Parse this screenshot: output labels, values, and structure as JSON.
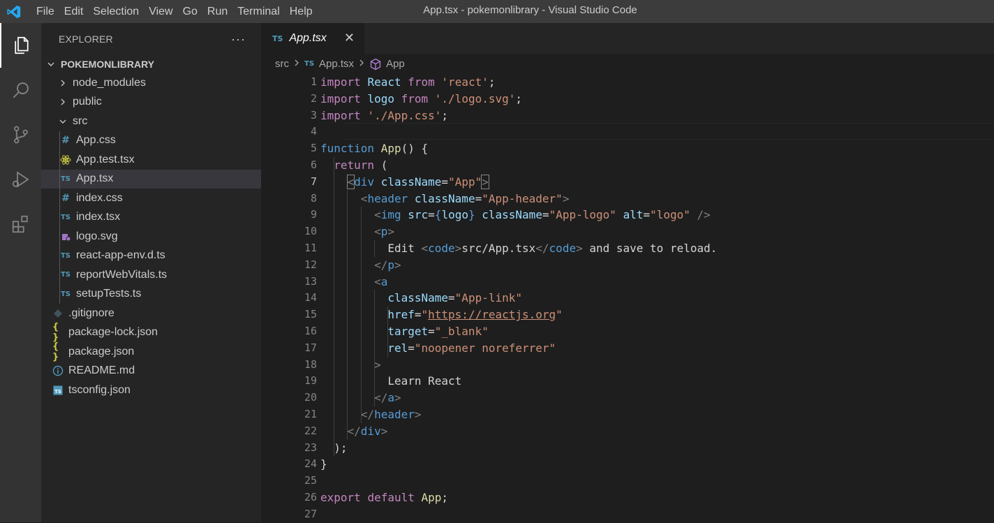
{
  "menu": [
    "File",
    "Edit",
    "Selection",
    "View",
    "Go",
    "Run",
    "Terminal",
    "Help"
  ],
  "window_title": "App.tsx - pokemonlibrary - Visual Studio Code",
  "explorer": {
    "title": "EXPLORER",
    "more": "···",
    "project": "POKEMONLIBRARY",
    "items": [
      {
        "label": "node_modules",
        "type": "folder",
        "open": false
      },
      {
        "label": "public",
        "type": "folder",
        "open": false
      },
      {
        "label": "src",
        "type": "folder",
        "open": true
      },
      {
        "label": "App.css",
        "type": "css"
      },
      {
        "label": "App.test.tsx",
        "type": "react"
      },
      {
        "label": "App.tsx",
        "type": "ts",
        "selected": true
      },
      {
        "label": "index.css",
        "type": "css"
      },
      {
        "label": "index.tsx",
        "type": "ts"
      },
      {
        "label": "logo.svg",
        "type": "svg"
      },
      {
        "label": "react-app-env.d.ts",
        "type": "ts"
      },
      {
        "label": "reportWebVitals.ts",
        "type": "ts"
      },
      {
        "label": "setupTests.ts",
        "type": "ts"
      },
      {
        "label": ".gitignore",
        "type": "git"
      },
      {
        "label": "package-lock.json",
        "type": "json"
      },
      {
        "label": "package.json",
        "type": "json"
      },
      {
        "label": "README.md",
        "type": "info"
      },
      {
        "label": "tsconfig.json",
        "type": "tsconfig"
      }
    ]
  },
  "icons": {
    "ts": "TS",
    "css": "#",
    "json": "{ }"
  },
  "tab": {
    "label": "App.tsx",
    "close": "✕"
  },
  "breadcrumb": {
    "folder": "src",
    "file": "App.tsx",
    "symbol": "App"
  },
  "code_lines": [
    [
      [
        "k",
        "import"
      ],
      [
        "w",
        " "
      ],
      [
        "v",
        "React"
      ],
      [
        "w",
        " "
      ],
      [
        "k",
        "from"
      ],
      [
        "w",
        " "
      ],
      [
        "s",
        "'react'"
      ],
      [
        "w",
        ";"
      ]
    ],
    [
      [
        "k",
        "import"
      ],
      [
        "w",
        " "
      ],
      [
        "v",
        "logo"
      ],
      [
        "w",
        " "
      ],
      [
        "k",
        "from"
      ],
      [
        "w",
        " "
      ],
      [
        "s",
        "'./logo.svg'"
      ],
      [
        "w",
        ";"
      ]
    ],
    [
      [
        "k",
        "import"
      ],
      [
        "w",
        " "
      ],
      [
        "s",
        "'./App.css'"
      ],
      [
        "w",
        ";"
      ]
    ],
    [],
    [
      [
        "b",
        "function"
      ],
      [
        "w",
        " "
      ],
      [
        "f",
        "App"
      ],
      [
        "w",
        "() {"
      ]
    ],
    [
      [
        "w",
        "  "
      ],
      [
        "k",
        "return"
      ],
      [
        "w",
        " ("
      ]
    ],
    [
      [
        "w",
        "    "
      ],
      [
        "g",
        "<"
      ],
      [
        "b",
        "div"
      ],
      [
        "w",
        " "
      ],
      [
        "v",
        "className"
      ],
      [
        "w",
        "="
      ],
      [
        "s",
        "\"App\""
      ],
      [
        "g",
        ">"
      ]
    ],
    [
      [
        "w",
        "      "
      ],
      [
        "g",
        "<"
      ],
      [
        "b",
        "header"
      ],
      [
        "w",
        " "
      ],
      [
        "v",
        "className"
      ],
      [
        "w",
        "="
      ],
      [
        "s",
        "\"App-header\""
      ],
      [
        "g",
        ">"
      ]
    ],
    [
      [
        "w",
        "        "
      ],
      [
        "g",
        "<"
      ],
      [
        "b",
        "img"
      ],
      [
        "w",
        " "
      ],
      [
        "v",
        "src"
      ],
      [
        "w",
        "="
      ],
      [
        "b",
        "{"
      ],
      [
        "v",
        "logo"
      ],
      [
        "b",
        "}"
      ],
      [
        "w",
        " "
      ],
      [
        "v",
        "className"
      ],
      [
        "w",
        "="
      ],
      [
        "s",
        "\"App-logo\""
      ],
      [
        "w",
        " "
      ],
      [
        "v",
        "alt"
      ],
      [
        "w",
        "="
      ],
      [
        "s",
        "\"logo\""
      ],
      [
        "w",
        " "
      ],
      [
        "g",
        "/>"
      ]
    ],
    [
      [
        "w",
        "        "
      ],
      [
        "g",
        "<"
      ],
      [
        "b",
        "p"
      ],
      [
        "g",
        ">"
      ]
    ],
    [
      [
        "w",
        "          Edit "
      ],
      [
        "g",
        "<"
      ],
      [
        "b",
        "code"
      ],
      [
        "g",
        ">"
      ],
      [
        "w",
        "src/App.tsx"
      ],
      [
        "g",
        "</"
      ],
      [
        "b",
        "code"
      ],
      [
        "g",
        ">"
      ],
      [
        "w",
        " and save to reload."
      ]
    ],
    [
      [
        "w",
        "        "
      ],
      [
        "g",
        "</"
      ],
      [
        "b",
        "p"
      ],
      [
        "g",
        ">"
      ]
    ],
    [
      [
        "w",
        "        "
      ],
      [
        "g",
        "<"
      ],
      [
        "b",
        "a"
      ]
    ],
    [
      [
        "w",
        "          "
      ],
      [
        "v",
        "className"
      ],
      [
        "w",
        "="
      ],
      [
        "s",
        "\"App-link\""
      ]
    ],
    [
      [
        "w",
        "          "
      ],
      [
        "v",
        "href"
      ],
      [
        "w",
        "="
      ],
      [
        "s",
        "\""
      ],
      [
        "su",
        "https://reactjs.org"
      ],
      [
        "s",
        "\""
      ]
    ],
    [
      [
        "w",
        "          "
      ],
      [
        "v",
        "target"
      ],
      [
        "w",
        "="
      ],
      [
        "s",
        "\"_blank\""
      ]
    ],
    [
      [
        "w",
        "          "
      ],
      [
        "v",
        "rel"
      ],
      [
        "w",
        "="
      ],
      [
        "s",
        "\"noopener noreferrer\""
      ]
    ],
    [
      [
        "w",
        "        "
      ],
      [
        "g",
        ">"
      ]
    ],
    [
      [
        "w",
        "          Learn React"
      ]
    ],
    [
      [
        "w",
        "        "
      ],
      [
        "g",
        "</"
      ],
      [
        "b",
        "a"
      ],
      [
        "g",
        ">"
      ]
    ],
    [
      [
        "w",
        "      "
      ],
      [
        "g",
        "</"
      ],
      [
        "b",
        "header"
      ],
      [
        "g",
        ">"
      ]
    ],
    [
      [
        "w",
        "    "
      ],
      [
        "g",
        "</"
      ],
      [
        "b",
        "div"
      ],
      [
        "g",
        ">"
      ]
    ],
    [
      [
        "w",
        "  );"
      ]
    ],
    [
      [
        "w",
        "}"
      ]
    ],
    [],
    [
      [
        "k",
        "export"
      ],
      [
        "w",
        " "
      ],
      [
        "k",
        "default"
      ],
      [
        "w",
        " "
      ],
      [
        "f",
        "App"
      ],
      [
        "w",
        ";"
      ]
    ],
    []
  ],
  "current_line": 7
}
